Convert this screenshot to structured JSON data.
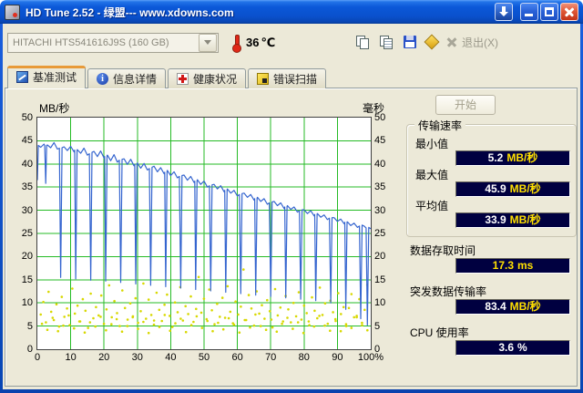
{
  "titlebar": {
    "title": "HD Tune 2.52 - 绿盟--- www.xdowns.com"
  },
  "toolbar": {
    "drive_select": "HITACHI HTS541616J9S (160 GB)",
    "temperature_value": "36",
    "temperature_unit": "℃",
    "exit_label": "退出(X)"
  },
  "tabs": [
    {
      "label": "基准测试"
    },
    {
      "label": "信息详情"
    },
    {
      "label": "健康状况"
    },
    {
      "label": "错误扫描"
    }
  ],
  "benchmark": {
    "start_button": "开始",
    "transfer_group_title": "传输速率",
    "stats": {
      "minimum": {
        "label": "最小值",
        "value": "5.2",
        "unit": "MB/秒"
      },
      "maximum": {
        "label": "最大值",
        "value": "45.9",
        "unit": "MB/秒"
      },
      "average": {
        "label": "平均值",
        "value": "33.9",
        "unit": "MB/秒"
      },
      "access_time": {
        "label": "数据存取时间",
        "value": "17.3",
        "unit": "ms"
      },
      "burst_rate": {
        "label": "突发数据传输率",
        "value": "83.4",
        "unit": "MB/秒"
      },
      "cpu_usage": {
        "label": "CPU 使用率",
        "value": "3.6",
        "unit": "%"
      }
    }
  },
  "chart_data": {
    "type": "line+scatter",
    "left_axis_label": "MB/秒",
    "right_axis_label": "毫秒",
    "xlim": [
      0,
      100
    ],
    "ylim": [
      0,
      50
    ],
    "grid": true,
    "grid_color": "#00b000",
    "line_color": "#3565cf",
    "scatter_color": "#d8d800",
    "y_ticks": [
      "50",
      "45",
      "40",
      "35",
      "30",
      "25",
      "20",
      "15",
      "10",
      "5",
      "0"
    ],
    "x_ticks": [
      "0",
      "10",
      "20",
      "30",
      "40",
      "50",
      "60",
      "70",
      "80",
      "90",
      "100%"
    ],
    "transfer_rate_min": 5.2,
    "transfer_rate_max": 45.9,
    "transfer_rate_avg": 33.9,
    "access_time_ms": 17.3,
    "burst_rate": 83.4,
    "cpu_usage_pct": 3.6,
    "line_points": [
      [
        0,
        36.5
      ],
      [
        0.3,
        44
      ],
      [
        1,
        43.6
      ],
      [
        2,
        44.3
      ],
      [
        2.2,
        44
      ],
      [
        2.5,
        35.8
      ],
      [
        2.8,
        44
      ],
      [
        3,
        44.1
      ],
      [
        4,
        43.5
      ],
      [
        5,
        44.6
      ],
      [
        6,
        43.2
      ],
      [
        6.6,
        43.4
      ],
      [
        7,
        15.5
      ],
      [
        7.4,
        43.5
      ],
      [
        8,
        43.7
      ],
      [
        9,
        42.9
      ],
      [
        10,
        43.8
      ],
      [
        11,
        42.6
      ],
      [
        11.2,
        43
      ],
      [
        11.5,
        15.2
      ],
      [
        11.9,
        43
      ],
      [
        12,
        43.1
      ],
      [
        13,
        42.3
      ],
      [
        14,
        43.4
      ],
      [
        15,
        41.9
      ],
      [
        15.6,
        42.2
      ],
      [
        16,
        14.9
      ],
      [
        16.4,
        42.5
      ],
      [
        17,
        42.7
      ],
      [
        18,
        41.6
      ],
      [
        19,
        42.8
      ],
      [
        20,
        41.3
      ],
      [
        20.2,
        41.6
      ],
      [
        20.5,
        14.7
      ],
      [
        20.9,
        41.8
      ],
      [
        21,
        41.9
      ],
      [
        22,
        40.7
      ],
      [
        23,
        42
      ],
      [
        24,
        40.4
      ],
      [
        24.6,
        40.8
      ],
      [
        25,
        14.4
      ],
      [
        25.4,
        41
      ],
      [
        26,
        41.1
      ],
      [
        27,
        39.9
      ],
      [
        28,
        41
      ],
      [
        29,
        39.6
      ],
      [
        29.2,
        39.9
      ],
      [
        29.5,
        14.1
      ],
      [
        29.9,
        40.1
      ],
      [
        30,
        40.2
      ],
      [
        31,
        39.1
      ],
      [
        32,
        40.1
      ],
      [
        33,
        38.7
      ],
      [
        33.6,
        39
      ],
      [
        34,
        13.8
      ],
      [
        34.4,
        39.3
      ],
      [
        35,
        39.5
      ],
      [
        36,
        38.3
      ],
      [
        37,
        39.2
      ],
      [
        38,
        37.9
      ],
      [
        38.2,
        38.2
      ],
      [
        38.5,
        13.5
      ],
      [
        38.9,
        38.4
      ],
      [
        39,
        38.6
      ],
      [
        40,
        37.5
      ],
      [
        41,
        38.3
      ],
      [
        42,
        37
      ],
      [
        42.6,
        37.3
      ],
      [
        43,
        13.2
      ],
      [
        43.4,
        37.5
      ],
      [
        44,
        37.6
      ],
      [
        45,
        36.5
      ],
      [
        46,
        37.3
      ],
      [
        47,
        36
      ],
      [
        47.2,
        36.3
      ],
      [
        47.5,
        12.9
      ],
      [
        47.9,
        36.4
      ],
      [
        48,
        36.6
      ],
      [
        49,
        35.6
      ],
      [
        50,
        36.3
      ],
      [
        51,
        35
      ],
      [
        51.6,
        35.3
      ],
      [
        52,
        12.6
      ],
      [
        52.4,
        35.5
      ],
      [
        53,
        35.6
      ],
      [
        54,
        34.6
      ],
      [
        55,
        35.3
      ],
      [
        56,
        34
      ],
      [
        56.2,
        34.3
      ],
      [
        56.5,
        12.3
      ],
      [
        56.9,
        34.4
      ],
      [
        57,
        34.6
      ],
      [
        58,
        33.7
      ],
      [
        59,
        34.3
      ],
      [
        60,
        33.1
      ],
      [
        60.6,
        33.4
      ],
      [
        61,
        12
      ],
      [
        61.4,
        33.6
      ],
      [
        62,
        33.7
      ],
      [
        63,
        32.8
      ],
      [
        64,
        33.4
      ],
      [
        65,
        32.2
      ],
      [
        65.2,
        32.5
      ],
      [
        65.5,
        11.7
      ],
      [
        65.9,
        32.6
      ],
      [
        66,
        32.8
      ],
      [
        67,
        31.9
      ],
      [
        68,
        32.5
      ],
      [
        69,
        31.3
      ],
      [
        69.6,
        31.6
      ],
      [
        70,
        11.4
      ],
      [
        70.4,
        31.8
      ],
      [
        71,
        31.9
      ],
      [
        72,
        31
      ],
      [
        73,
        31.6
      ],
      [
        74,
        30.4
      ],
      [
        74.2,
        30.7
      ],
      [
        74.5,
        11.1
      ],
      [
        74.9,
        30.8
      ],
      [
        75,
        31
      ],
      [
        76,
        30.2
      ],
      [
        77,
        30.7
      ],
      [
        78,
        29.6
      ],
      [
        78.6,
        29.9
      ],
      [
        79,
        10.8
      ],
      [
        79.4,
        30.1
      ],
      [
        80,
        30.1
      ],
      [
        81,
        29.3
      ],
      [
        82,
        29.9
      ],
      [
        83,
        28.8
      ],
      [
        83.2,
        29.1
      ],
      [
        83.5,
        10.5
      ],
      [
        83.9,
        29.2
      ],
      [
        84,
        29.3
      ],
      [
        85,
        28.5
      ],
      [
        86,
        29
      ],
      [
        87,
        28
      ],
      [
        87.6,
        28.3
      ],
      [
        88,
        10
      ],
      [
        88.4,
        28.4
      ],
      [
        89,
        28.4
      ],
      [
        90,
        27.6
      ],
      [
        91,
        28.1
      ],
      [
        92,
        27.1
      ],
      [
        92.2,
        27.4
      ],
      [
        92.5,
        8.6
      ],
      [
        92.9,
        27.5
      ],
      [
        93,
        27.5
      ],
      [
        94,
        26.7
      ],
      [
        95,
        27.2
      ],
      [
        96,
        26.3
      ],
      [
        96.6,
        26.6
      ],
      [
        97,
        6.6
      ],
      [
        97.4,
        26.8
      ],
      [
        98,
        26.6
      ],
      [
        98.6,
        26.2
      ],
      [
        99,
        5.2
      ],
      [
        99.4,
        26.3
      ],
      [
        100,
        26
      ]
    ],
    "scatter": [
      {
        "x_start": 1,
        "x_step": 0.79,
        "y": [
          7.5,
          10.2,
          5.8,
          12.4,
          8.1,
          6.3,
          9.7,
          4.9,
          11.3,
          7.0,
          8.8,
          5.2,
          13.1,
          7.7,
          9.4,
          6.0,
          10.8,
          8.3,
          4.6,
          12.0,
          6.7,
          9.1,
          7.3,
          11.6,
          5.5,
          8.6,
          13.8,
          6.9,
          10.4,
          7.8,
          5.0,
          12.7,
          8.9,
          6.4,
          9.9,
          7.1,
          11.0,
          5.7,
          8.2,
          14.2,
          6.6,
          10.7,
          7.4,
          5.3,
          12.2,
          8.5,
          6.1,
          9.6,
          11.8,
          7.2,
          4.8,
          10.1,
          8.0,
          13.4,
          6.2,
          9.3,
          7.6,
          11.4,
          5.9,
          8.7,
          15.6,
          7.9,
          10.9,
          6.5,
          12.9,
          8.4,
          5.4,
          9.8,
          7.0,
          11.1,
          6.8,
          13.6,
          8.1,
          5.6,
          10.3,
          7.5,
          9.2,
          17.2,
          6.3,
          11.7,
          8.8,
          5.1,
          12.5,
          7.7,
          9.5,
          6.6,
          10.6,
          8.2,
          4.7,
          13.0,
          7.3,
          9.0,
          6.0,
          11.5,
          8.6,
          5.8,
          10.0,
          7.1,
          12.3,
          6.4,
          9.4,
          7.8,
          5.2,
          11.2,
          8.3,
          6.7,
          13.3,
          7.4,
          9.9,
          5.5,
          10.5,
          8.0,
          6.1,
          12.1,
          7.6,
          9.1,
          5.0,
          8.9,
          11.9,
          6.9,
          7.2,
          10.8,
          5.7,
          8.5,
          13.9
        ]
      },
      {
        "x_start": 1.4,
        "x_step": 1.6,
        "y": [
          5.5,
          4.2,
          6.8,
          3.9,
          5.1,
          7.3,
          4.5,
          6.0,
          3.6,
          5.8,
          4.9,
          7.0,
          4.1,
          5.4,
          6.5,
          3.8,
          5.0,
          6.9,
          4.4,
          5.9,
          3.5,
          6.2,
          4.8,
          7.4,
          4.0,
          5.6,
          6.6,
          3.7,
          5.2,
          7.1,
          4.6,
          6.1,
          3.9,
          5.7,
          4.3,
          6.7,
          5.3,
          3.6,
          6.3,
          4.7,
          7.5,
          5.0,
          4.2,
          6.4,
          3.8,
          5.5,
          6.8,
          4.4,
          5.8,
          3.5,
          6.0,
          4.9,
          7.2,
          5.1,
          4.0,
          6.5,
          3.9,
          5.4,
          4.6,
          6.9,
          5.2,
          4.1
        ]
      }
    ]
  }
}
